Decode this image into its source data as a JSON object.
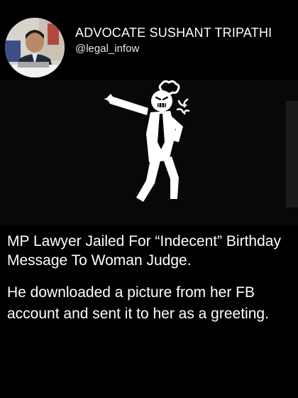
{
  "post": {
    "author": {
      "name": "ADVOCATE SUSHANT TRIPATHI",
      "handle": "@legal_infow"
    },
    "media": {
      "illustration": "angry-stick-figure-pointing",
      "icons": [
        "angry-face-icon",
        "anger-symbol-icon",
        "anger-puff-icon"
      ]
    },
    "headline": "MP Lawyer Jailed For “Indecent” Birthday Message To Woman Judge.",
    "body": "He downloaded a picture from her FB account and sent it to her as a greeting."
  },
  "colors": {
    "background": "#000000",
    "media_background": "#080808",
    "text": "#ffffff"
  }
}
